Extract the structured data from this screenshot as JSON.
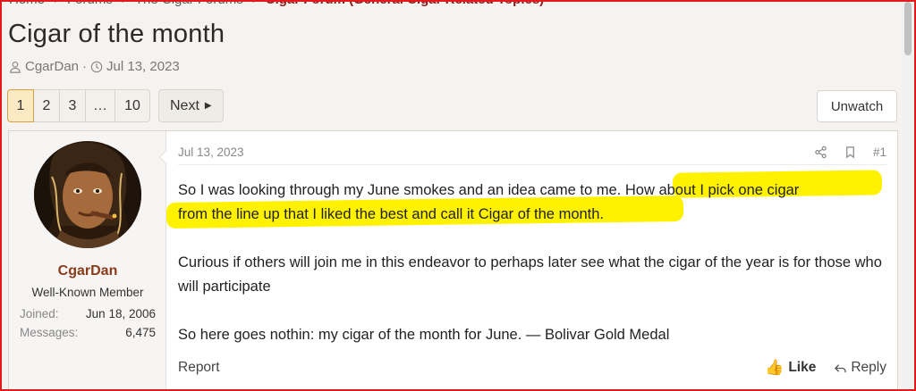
{
  "breadcrumbs": [
    "Home",
    "Forums",
    "The Cigar Forums",
    "Cigar Forum (General Cigar Related Topics)"
  ],
  "thread": {
    "title": "Cigar of the month",
    "author": "CgarDan",
    "date": "Jul 13, 2023"
  },
  "pagination": {
    "pages": [
      "1",
      "2",
      "3",
      "…",
      "10"
    ],
    "current": "1",
    "next_label": "Next"
  },
  "unwatch_label": "Unwatch",
  "post": {
    "user": {
      "name": "CgarDan",
      "title": "Well-Known Member",
      "stats": [
        {
          "label": "Joined:",
          "value": "Jun 18, 2006"
        },
        {
          "label": "Messages:",
          "value": "6,475"
        }
      ]
    },
    "date": "Jul 13, 2023",
    "number": "#1",
    "para1_a": "So I was looking through my June smokes and an idea came to me.",
    "para1_b": " How about I pick one cigar",
    "para1_c": "from the line up that I liked the best and call it Cigar of the month.",
    "para2": "Curious if others will join me in this endeavor to perhaps later see what the cigar of the year is for those who will participate",
    "para3": "So here goes nothin: my cigar of the month for June. — Bolivar Gold Medal",
    "report_label": "Report",
    "like_label": "Like",
    "reply_label": "Reply"
  },
  "colors": {
    "highlight": "#fff200",
    "username": "#8a3b1b",
    "page_active_bg": "#fbe9c4",
    "annotation_border": "#e01b1b"
  }
}
